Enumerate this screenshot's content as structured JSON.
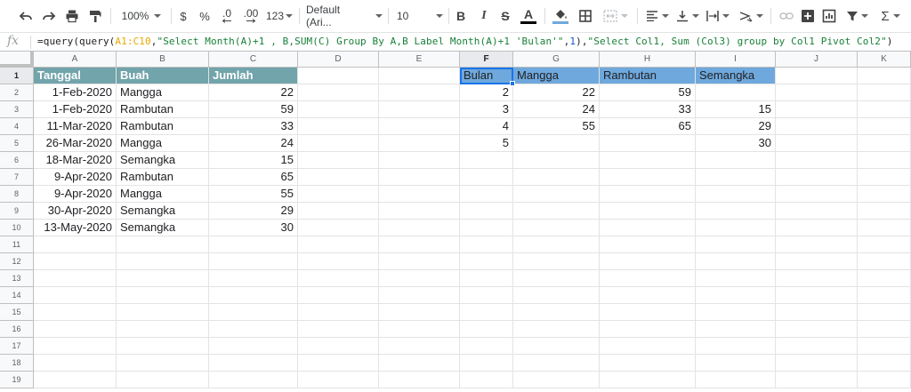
{
  "toolbar": {
    "zoom": "100%",
    "currency_symbol": "$",
    "percent_symbol": "%",
    "decrease_decimals_label": ".0",
    "increase_decimals_label": ".00",
    "more_formats_label": "123",
    "font_family": "Default (Ari...",
    "font_size": "10",
    "bold_label": "B",
    "italic_label": "I",
    "strikethrough_label": "S",
    "text_color_label": "A",
    "sum_symbol": "Σ",
    "text_color_swatch": "#000000",
    "fill_color_swatch": "#6fa8dc"
  },
  "formula_bar": {
    "fx_label": "fx",
    "part1": "=query(query(",
    "range": "A1:C10",
    "part2": ",",
    "str1": "\"Select Month(A)+1 , B,SUM(C) Group By A,B Label Month(A)+1 'Bulan'\"",
    "part3": ",",
    "num1": "1",
    "part4": "),",
    "str2": "\"Select Col1, Sum (Col3) group by Col1 Pivot Col2\"",
    "part5": ")"
  },
  "columns": [
    "A",
    "B",
    "C",
    "D",
    "E",
    "F",
    "G",
    "H",
    "I",
    "J",
    "K"
  ],
  "rows": [
    "1",
    "2",
    "3",
    "4",
    "5",
    "6",
    "7",
    "8",
    "9",
    "10",
    "11",
    "12",
    "13",
    "14",
    "15",
    "16",
    "17",
    "18",
    "19"
  ],
  "source_table": {
    "headers": [
      "Tanggal",
      "Buah",
      "Jumlah"
    ],
    "rows": [
      [
        "1-Feb-2020",
        "Mangga",
        "22"
      ],
      [
        "1-Feb-2020",
        "Rambutan",
        "59"
      ],
      [
        "11-Mar-2020",
        "Rambutan",
        "33"
      ],
      [
        "26-Mar-2020",
        "Mangga",
        "24"
      ],
      [
        "18-Mar-2020",
        "Semangka",
        "15"
      ],
      [
        "9-Apr-2020",
        "Rambutan",
        "65"
      ],
      [
        "9-Apr-2020",
        "Mangga",
        "55"
      ],
      [
        "30-Apr-2020",
        "Semangka",
        "29"
      ],
      [
        "13-May-2020",
        "Semangka",
        "30"
      ]
    ]
  },
  "pivot_table": {
    "headers": [
      "Bulan",
      "Mangga",
      "Rambutan",
      "Semangka"
    ],
    "rows": [
      [
        "2",
        "22",
        "59",
        ""
      ],
      [
        "3",
        "24",
        "33",
        "15"
      ],
      [
        "4",
        "55",
        "65",
        "29"
      ],
      [
        "5",
        "",
        "",
        "30"
      ]
    ]
  },
  "colors": {
    "source_header_bg": "#72a4ab",
    "pivot_header_bg": "#6fa8dc",
    "selection": "#1a73e8"
  }
}
